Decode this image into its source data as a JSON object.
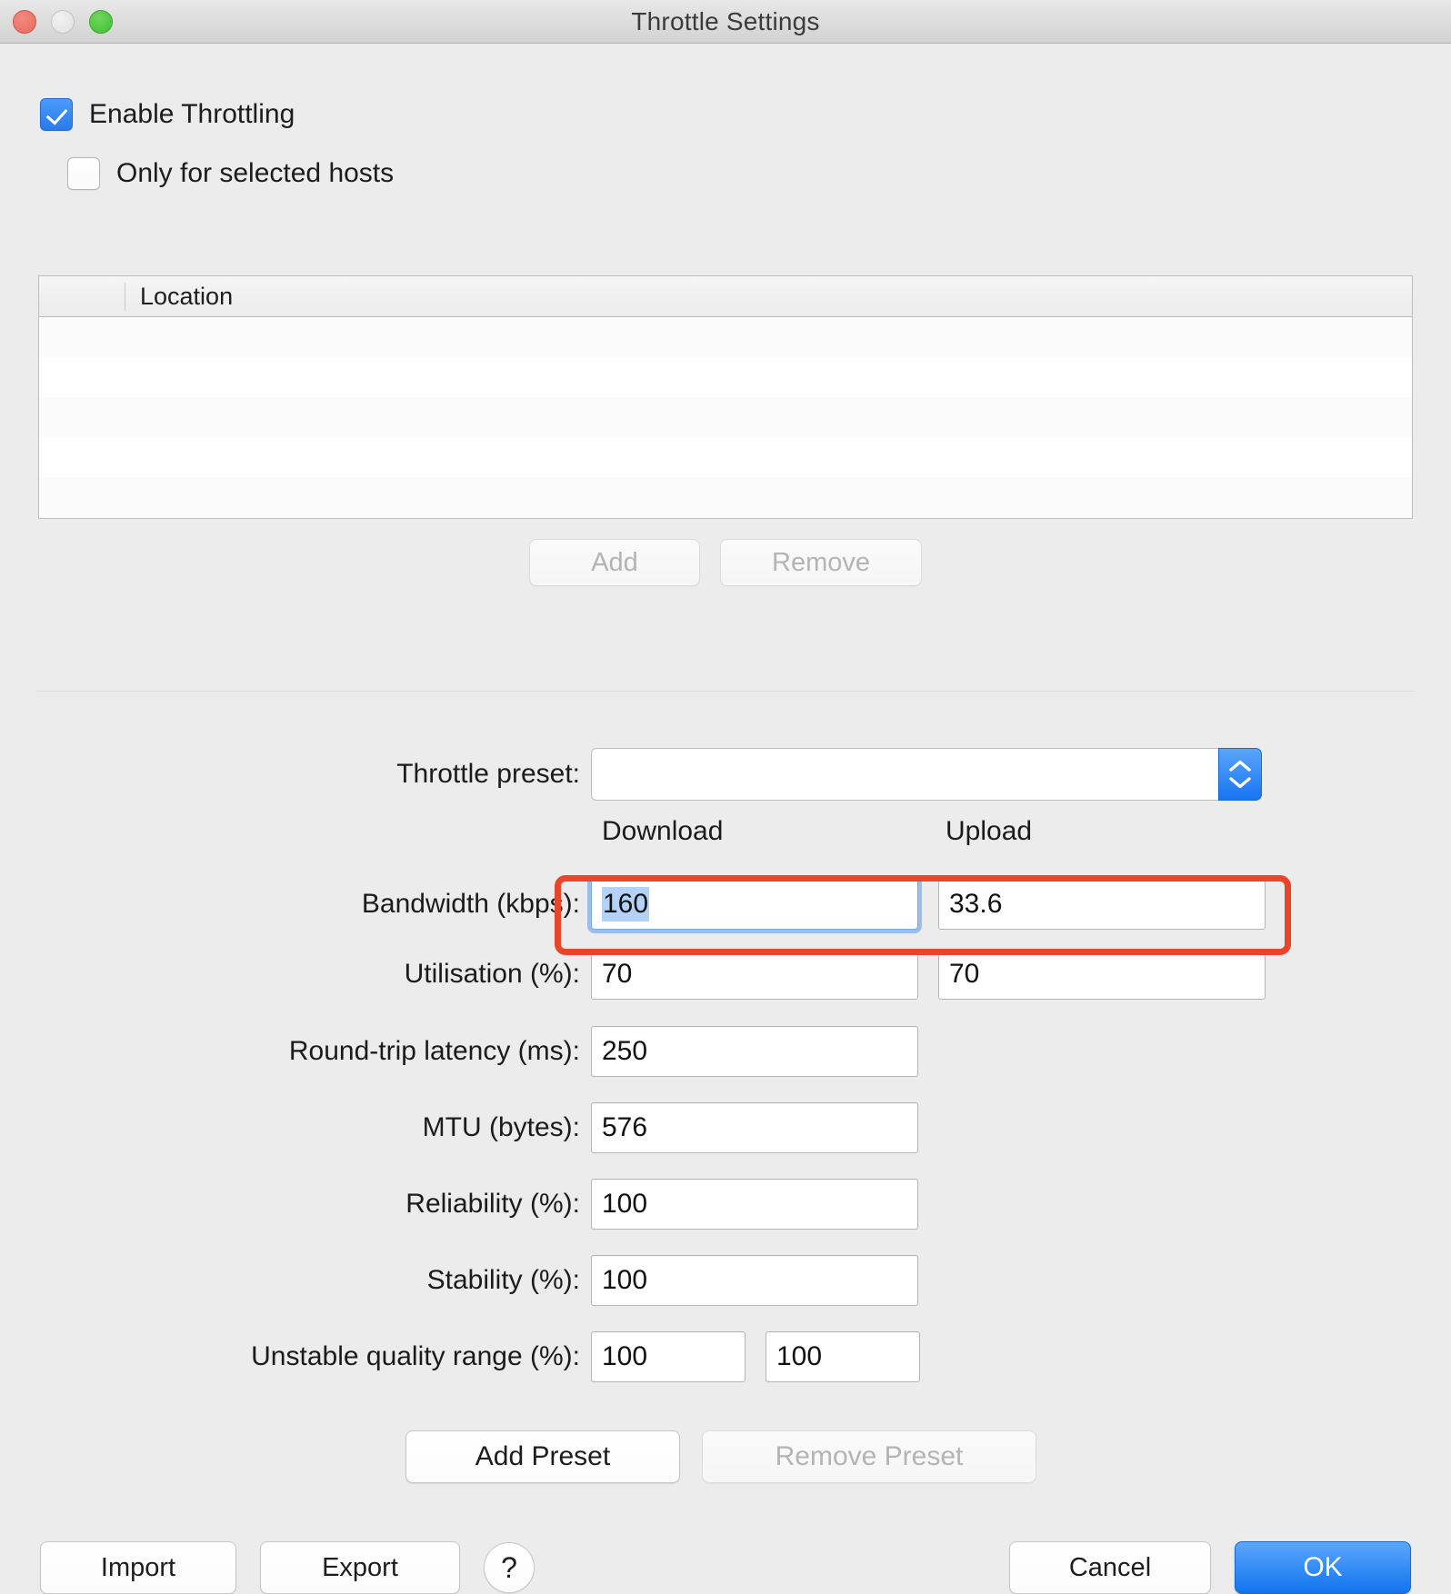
{
  "window": {
    "title": "Throttle Settings",
    "traffic_lights": [
      "close-button",
      "minimize-button",
      "zoom-button"
    ]
  },
  "options": {
    "enable_throttling": {
      "label": "Enable Throttling",
      "checked": true
    },
    "only_selected_hosts": {
      "label": "Only for selected hosts",
      "checked": false
    }
  },
  "hosts_table": {
    "columns": [
      "",
      "Location"
    ],
    "location_header": "Location",
    "rows": []
  },
  "list_actions": {
    "add_label": "Add",
    "add_enabled": false,
    "remove_label": "Remove",
    "remove_enabled": false
  },
  "preset": {
    "label": "Throttle preset:",
    "value": "",
    "placeholder": ""
  },
  "columns": {
    "download": "Download",
    "upload": "Upload"
  },
  "fields": [
    {
      "label": "Bandwidth (kbps):",
      "download": "160",
      "upload": "33.6",
      "focused": true,
      "selected": true
    },
    {
      "label": "Utilisation (%):",
      "download": "70",
      "upload": "70",
      "focused": false,
      "selected": false
    },
    {
      "label": "Round-trip latency (ms):",
      "download": "250",
      "upload": null,
      "focused": false,
      "selected": false
    },
    {
      "label": "MTU (bytes):",
      "download": "576",
      "upload": null,
      "focused": false,
      "selected": false
    },
    {
      "label": "Reliability (%):",
      "download": "100",
      "upload": null,
      "focused": false,
      "selected": false
    },
    {
      "label": "Stability (%):",
      "download": "100",
      "upload": null,
      "focused": false,
      "selected": false
    }
  ],
  "unstable_range": {
    "label": "Unstable quality range (%):",
    "min": "100",
    "max": "100"
  },
  "preset_actions": {
    "add_label": "Add Preset",
    "add_enabled": true,
    "remove_label": "Remove Preset",
    "remove_enabled": false
  },
  "footer": {
    "import_label": "Import",
    "export_label": "Export",
    "help_label": "?",
    "cancel_label": "Cancel",
    "ok_label": "OK"
  },
  "colors": {
    "accent_blue": "#1775f1",
    "annotation_red": "#e8462a",
    "window_bg": "#ececec",
    "selection_blue": "#b4d2f5"
  }
}
